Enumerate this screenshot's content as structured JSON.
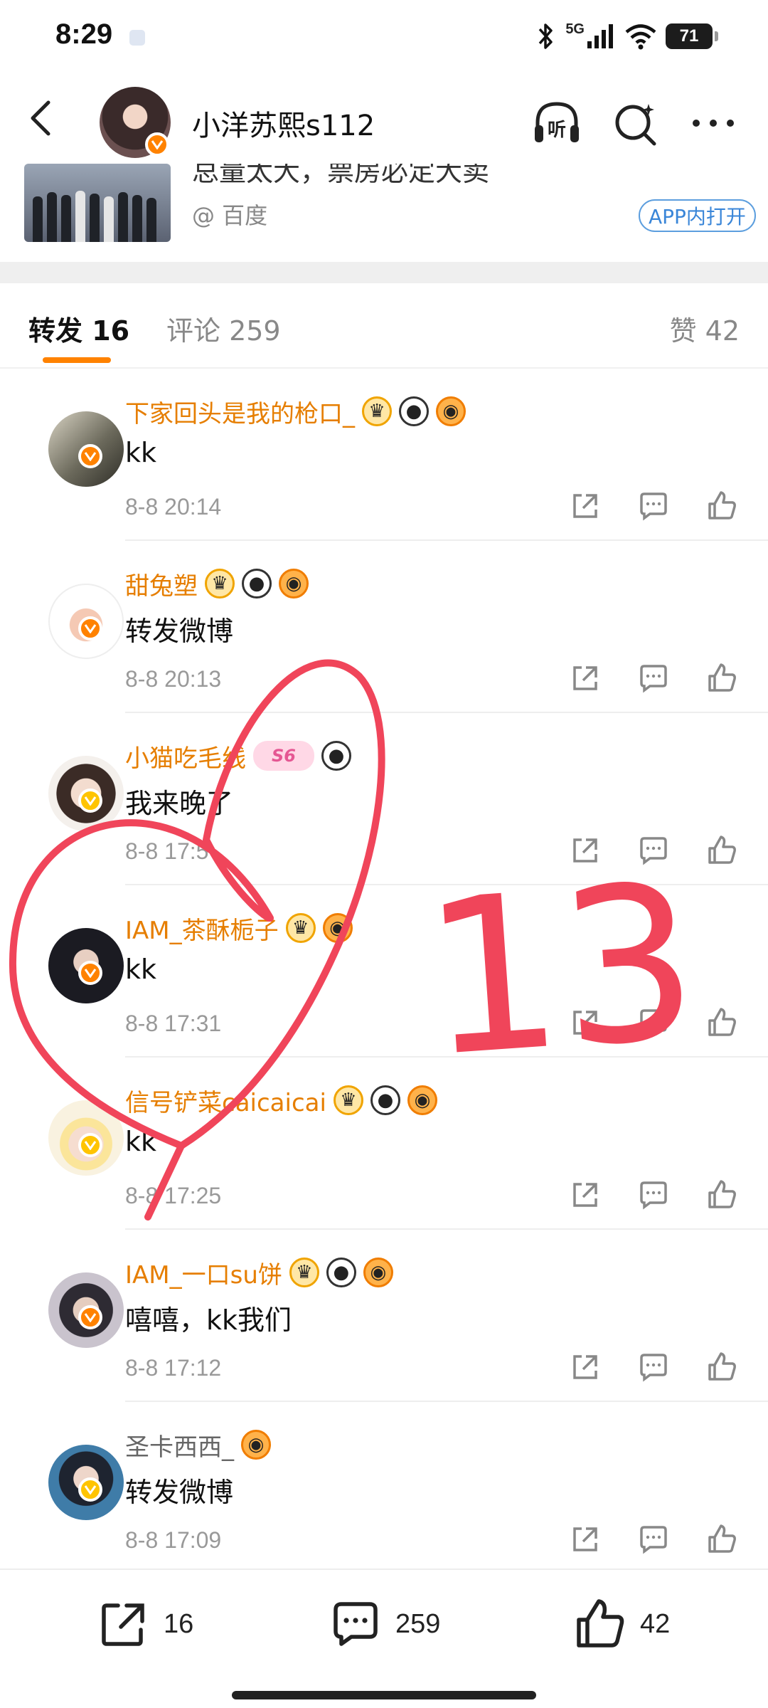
{
  "status_bar": {
    "time": "8:29",
    "network": "5G",
    "battery": "71"
  },
  "header": {
    "title": "小洋苏熙s112",
    "back_icon": "back-arrow-icon",
    "listen_icon": "headphones-listen-icon",
    "search_icon": "search-icon",
    "more_icon": "more-icon"
  },
  "link_card": {
    "title": "总量太大，票房必定大卖",
    "source": "@ 百度",
    "open_in_app": "APP内打开"
  },
  "tabs": {
    "repost_label": "转发 16",
    "comment_label": "评论 259",
    "like_label": "赞 42"
  },
  "comments": [
    {
      "name": "下家回头是我的枪口_",
      "text": "kk",
      "time": "8-8 20:14"
    },
    {
      "name": "甜兔塑",
      "text": "转发微博",
      "time": "8-8 20:13"
    },
    {
      "name": "小猫吃毛线",
      "text": "我来晚了",
      "time": "8-8 17:5",
      "badge_text": "S6"
    },
    {
      "name": "IAM_茶酥栀子",
      "text": "kk",
      "time": "8-8 17:31"
    },
    {
      "name": "信号铲菜caicaicai",
      "text": "kk",
      "time": "8-8 17:25"
    },
    {
      "name": "IAM_一口su饼",
      "text": "嘻嘻，kk我们",
      "time": "8-8 17:12"
    },
    {
      "name": "圣卡西西_",
      "text": "转发微博",
      "time": "8-8 17:09"
    }
  ],
  "bottom_bar": {
    "repost_count": "16",
    "comment_count": "259",
    "like_count": "42"
  },
  "annotation": {
    "handwritten_number": "13",
    "color": "#f0455a"
  },
  "colors": {
    "accent": "#ff8200",
    "username": "#e67e00",
    "link_blue": "#3a86d8"
  }
}
